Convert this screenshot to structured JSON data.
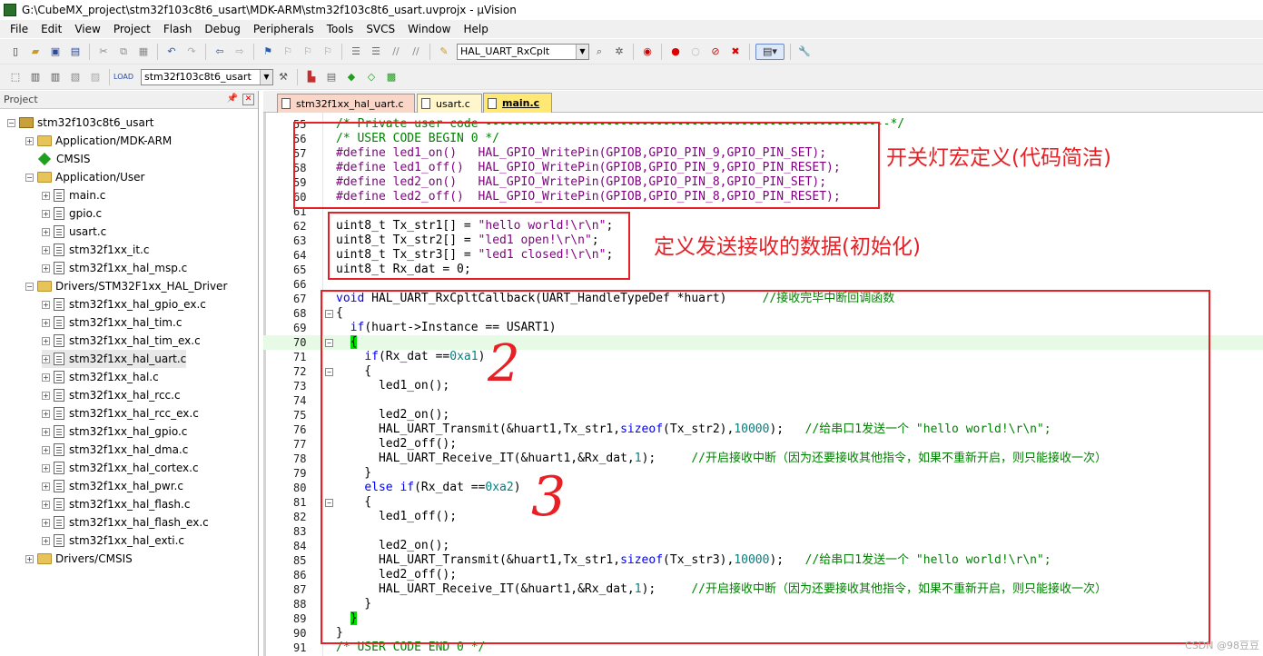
{
  "window": {
    "title": "G:\\CubeMX_project\\stm32f103c8t6_usart\\MDK-ARM\\stm32f103c8t6_usart.uvprojx - µVision"
  },
  "menu": [
    "File",
    "Edit",
    "View",
    "Project",
    "Flash",
    "Debug",
    "Peripherals",
    "Tools",
    "SVCS",
    "Window",
    "Help"
  ],
  "toolbar": {
    "find_combo": "HAL_UART_RxCplt",
    "target_combo": "stm32f103c8t6_usart"
  },
  "project": {
    "header": "Project",
    "root": "stm32f103c8t6_usart",
    "items": [
      {
        "label": "Application/MDK-ARM",
        "kind": "folder",
        "level": 1
      },
      {
        "label": "CMSIS",
        "kind": "component",
        "level": 1
      },
      {
        "label": "Application/User",
        "kind": "folder",
        "level": 1,
        "open": true
      },
      {
        "label": "main.c",
        "kind": "file",
        "level": 2
      },
      {
        "label": "gpio.c",
        "kind": "file",
        "level": 2
      },
      {
        "label": "usart.c",
        "kind": "file",
        "level": 2
      },
      {
        "label": "stm32f1xx_it.c",
        "kind": "file",
        "level": 2
      },
      {
        "label": "stm32f1xx_hal_msp.c",
        "kind": "file",
        "level": 2
      },
      {
        "label": "Drivers/STM32F1xx_HAL_Driver",
        "kind": "folder",
        "level": 1,
        "open": true
      },
      {
        "label": "stm32f1xx_hal_gpio_ex.c",
        "kind": "file",
        "level": 2
      },
      {
        "label": "stm32f1xx_hal_tim.c",
        "kind": "file",
        "level": 2
      },
      {
        "label": "stm32f1xx_hal_tim_ex.c",
        "kind": "file",
        "level": 2
      },
      {
        "label": "stm32f1xx_hal_uart.c",
        "kind": "file",
        "level": 2
      },
      {
        "label": "stm32f1xx_hal.c",
        "kind": "file",
        "level": 2
      },
      {
        "label": "stm32f1xx_hal_rcc.c",
        "kind": "file",
        "level": 2
      },
      {
        "label": "stm32f1xx_hal_rcc_ex.c",
        "kind": "file",
        "level": 2
      },
      {
        "label": "stm32f1xx_hal_gpio.c",
        "kind": "file",
        "level": 2
      },
      {
        "label": "stm32f1xx_hal_dma.c",
        "kind": "file",
        "level": 2
      },
      {
        "label": "stm32f1xx_hal_cortex.c",
        "kind": "file",
        "level": 2
      },
      {
        "label": "stm32f1xx_hal_pwr.c",
        "kind": "file",
        "level": 2
      },
      {
        "label": "stm32f1xx_hal_flash.c",
        "kind": "file",
        "level": 2
      },
      {
        "label": "stm32f1xx_hal_flash_ex.c",
        "kind": "file",
        "level": 2
      },
      {
        "label": "stm32f1xx_hal_exti.c",
        "kind": "file",
        "level": 2
      },
      {
        "label": "Drivers/CMSIS",
        "kind": "folder",
        "level": 1
      }
    ]
  },
  "tabs": [
    {
      "label": "stm32f1xx_hal_uart.c",
      "active": false
    },
    {
      "label": "usart.c",
      "active": false
    },
    {
      "label": "main.c",
      "active": true
    }
  ],
  "code": [
    {
      "n": "55",
      "t": "/* Private user code ---------------------------------------------------------*/"
    },
    {
      "n": "56",
      "t": "/* USER CODE BEGIN 0 */"
    },
    {
      "n": "57",
      "t": "#define led1_on()   HAL_GPIO_WritePin(GPIOB,GPIO_PIN_9,GPIO_PIN_SET);"
    },
    {
      "n": "58",
      "t": "#define led1_off()  HAL_GPIO_WritePin(GPIOB,GPIO_PIN_9,GPIO_PIN_RESET);"
    },
    {
      "n": "59",
      "t": "#define led2_on()   HAL_GPIO_WritePin(GPIOB,GPIO_PIN_8,GPIO_PIN_SET);"
    },
    {
      "n": "60",
      "t": "#define led2_off()  HAL_GPIO_WritePin(GPIOB,GPIO_PIN_8,GPIO_PIN_RESET);"
    },
    {
      "n": "61",
      "t": ""
    },
    {
      "n": "62",
      "t": "uint8_t Tx_str1[] = \"hello world!\\r\\n\";"
    },
    {
      "n": "63",
      "t": "uint8_t Tx_str2[] = \"led1 open!\\r\\n\";"
    },
    {
      "n": "64",
      "t": "uint8_t Tx_str3[] = \"led1 closed!\\r\\n\";"
    },
    {
      "n": "65",
      "t": "uint8_t Rx_dat = 0;"
    },
    {
      "n": "66",
      "t": ""
    },
    {
      "n": "67",
      "t": "void HAL_UART_RxCpltCallback(UART_HandleTypeDef *huart)     //接收完毕中断回调函数"
    },
    {
      "n": "68",
      "t": "{"
    },
    {
      "n": "69",
      "t": "  if(huart->Instance == USART1)"
    },
    {
      "n": "70",
      "t": "  {"
    },
    {
      "n": "71",
      "t": "    if(Rx_dat ==0xa1)"
    },
    {
      "n": "72",
      "t": "    {"
    },
    {
      "n": "73",
      "t": "      led1_on();"
    },
    {
      "n": "74",
      "t": ""
    },
    {
      "n": "75",
      "t": "      led2_on();"
    },
    {
      "n": "76",
      "t": "      HAL_UART_Transmit(&huart1,Tx_str1,sizeof(Tx_str2),10000);   //给串口1发送一个 \"hello world!\\r\\n\";"
    },
    {
      "n": "77",
      "t": "      led2_off();"
    },
    {
      "n": "78",
      "t": "      HAL_UART_Receive_IT(&huart1,&Rx_dat,1);     //开启接收中断（因为还要接收其他指令，如果不重新开启，则只能接收一次）"
    },
    {
      "n": "79",
      "t": "    }"
    },
    {
      "n": "80",
      "t": "    else if(Rx_dat ==0xa2)"
    },
    {
      "n": "81",
      "t": "    {"
    },
    {
      "n": "82",
      "t": "      led1_off();"
    },
    {
      "n": "83",
      "t": ""
    },
    {
      "n": "84",
      "t": "      led2_on();"
    },
    {
      "n": "85",
      "t": "      HAL_UART_Transmit(&huart1,Tx_str1,sizeof(Tx_str3),10000);   //给串口1发送一个 \"hello world!\\r\\n\";"
    },
    {
      "n": "86",
      "t": "      led2_off();"
    },
    {
      "n": "87",
      "t": "      HAL_UART_Receive_IT(&huart1,&Rx_dat,1);     //开启接收中断（因为还要接收其他指令，如果不重新开启，则只能接收一次）"
    },
    {
      "n": "88",
      "t": "    }"
    },
    {
      "n": "89",
      "t": "  }"
    },
    {
      "n": "90",
      "t": "}"
    },
    {
      "n": "91",
      "t": "/* USER CODE END 0 */"
    }
  ],
  "annotations": {
    "a1": "开关灯宏定义(代码简洁)",
    "a2": "定义发送接收的数据(初始化)",
    "n2": "2",
    "n3": "3"
  },
  "watermark": "CSDN @98豆豆",
  "colors": {
    "annotation": "#e81f24",
    "comment": "#008000",
    "keyword": "#0000ff",
    "preprocessor": "#7f007f",
    "number": "#008080"
  }
}
